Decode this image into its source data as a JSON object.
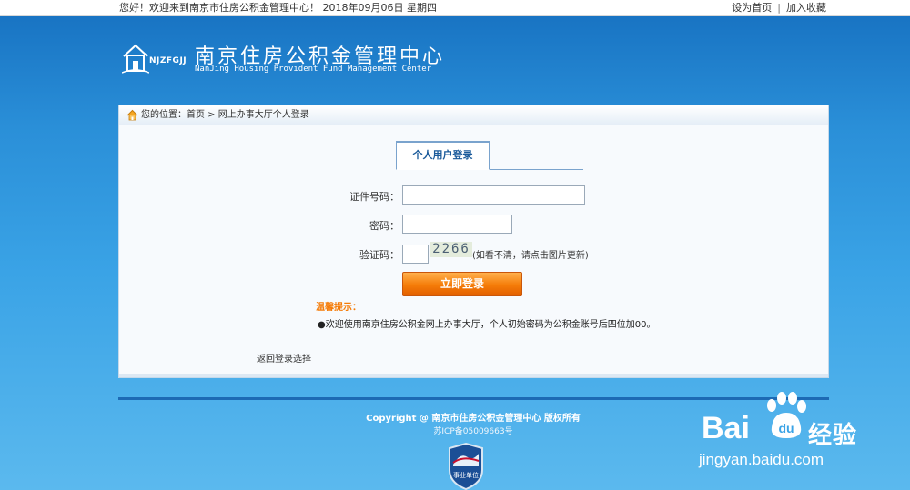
{
  "topbar": {
    "welcome": "您好！欢迎来到南京市住房公积金管理中心！   2018年09月06日 星期四",
    "set_home": "设为首页",
    "separator": "|",
    "bookmark": "加入收藏"
  },
  "header": {
    "logo_abbr": "NJZFGJJ",
    "title_cn": "南京住房公积金管理中心",
    "title_en": "NanJing Housing Provident Fund Management Center"
  },
  "breadcrumb": {
    "text": "您的位置：首页 > 网上办事大厅个人登录"
  },
  "login": {
    "tab": "个人用户登录",
    "id_label": "证件号码：",
    "id_value": "",
    "password_label": "密码：",
    "password_value": "",
    "captcha_label": "验证码：",
    "captcha_value": "",
    "captcha_image_text": "2266",
    "captcha_hint": "(如看不清，请点击图片更新)",
    "submit": "立即登录",
    "tip_title": "温馨提示：",
    "tip_text": "●欢迎使用南京住房公积金网上办事大厅，个人初始密码为公积金账号后四位加00。",
    "back_link": "返回登录选择"
  },
  "footer": {
    "copyright": "Copyright @ 南京市住房公积金管理中心 版权所有",
    "icp": "苏ICP备05009663号",
    "badge": "事业单位"
  },
  "watermark": {
    "brand": "Bai",
    "brand_suffix": "经验",
    "url": "jingyan.baidu.com"
  },
  "colors": {
    "accent_orange": "#f57c08",
    "brand_blue": "#1670c0"
  }
}
